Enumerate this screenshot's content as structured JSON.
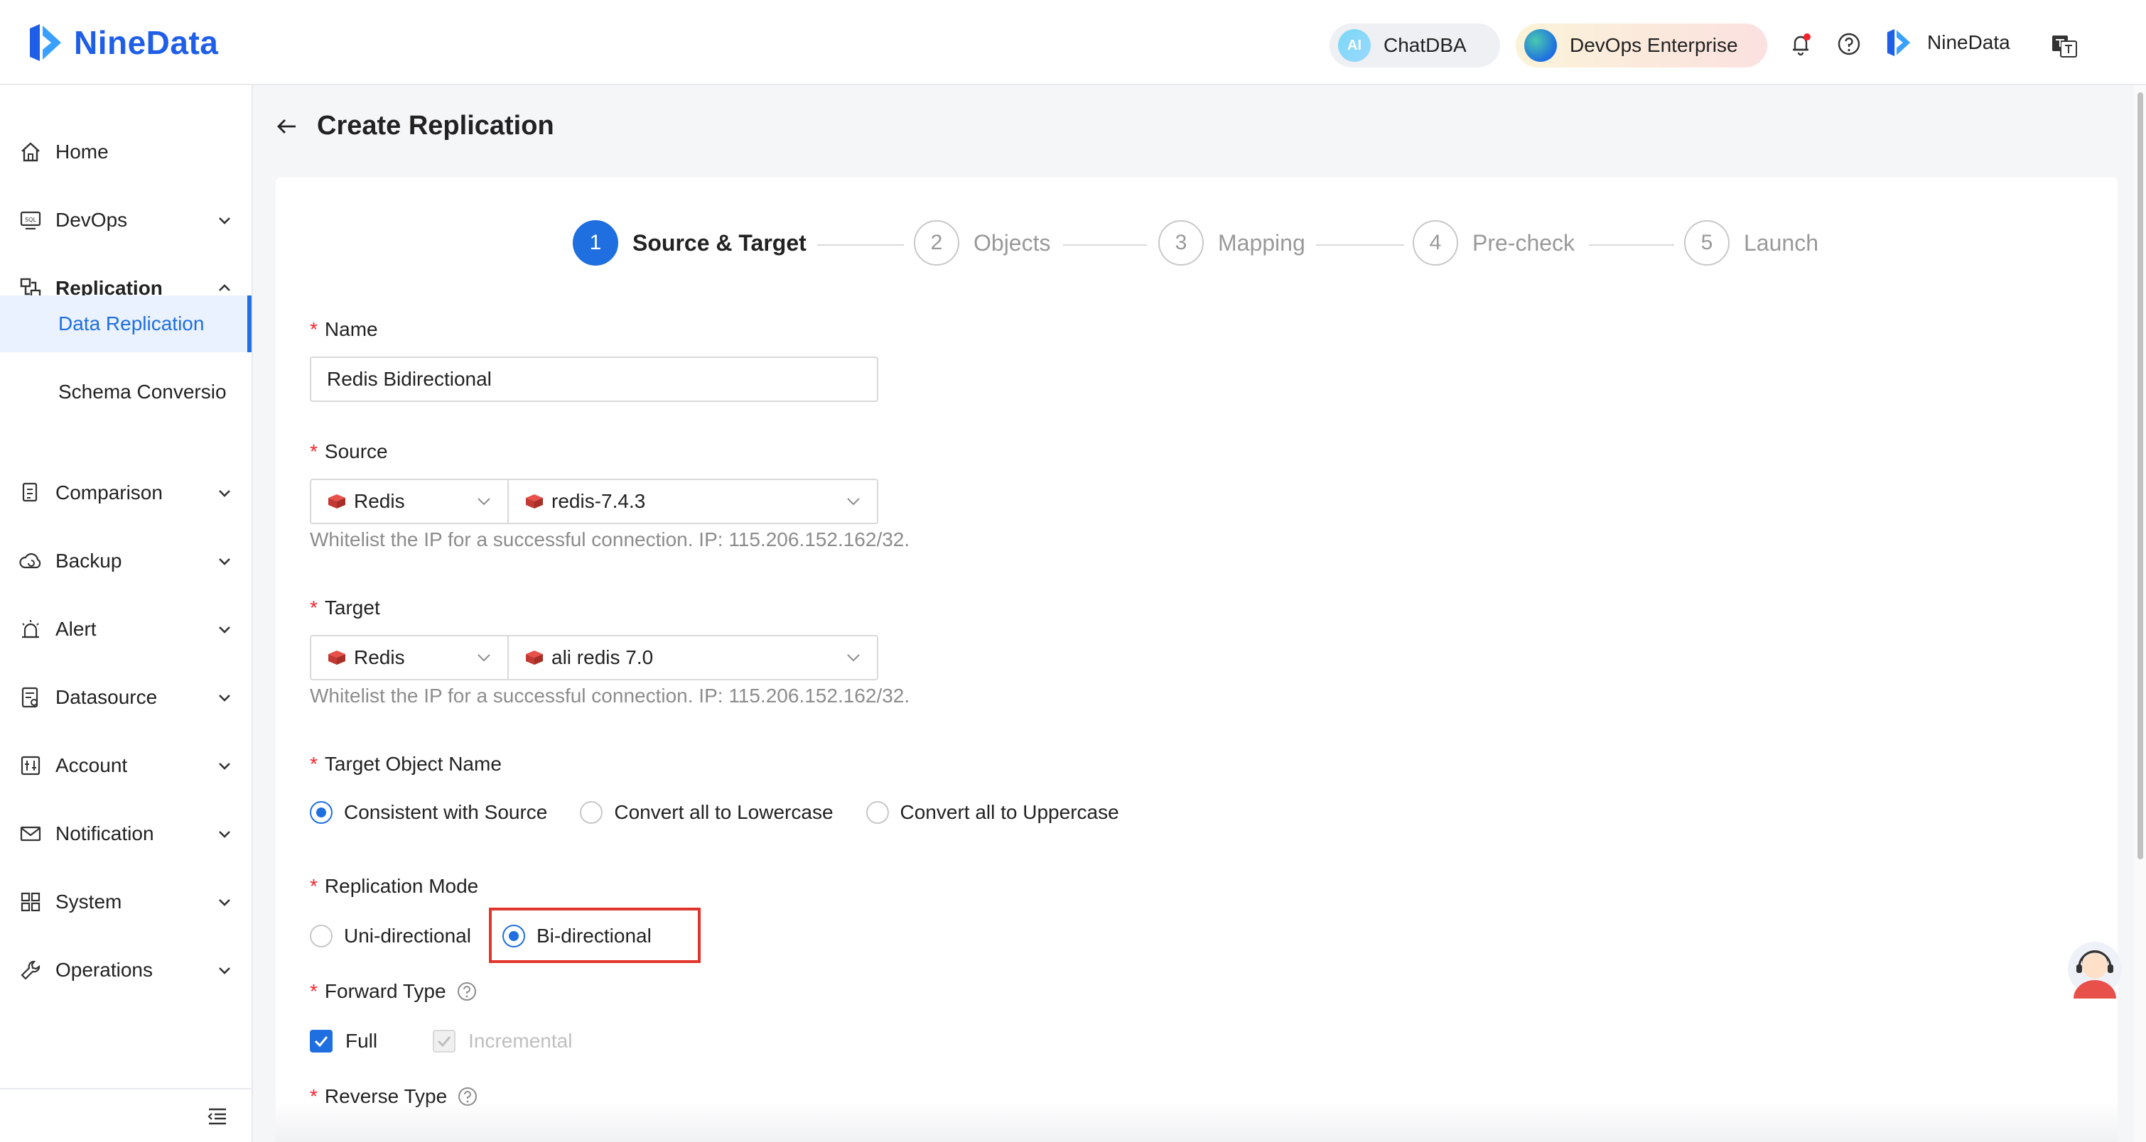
{
  "app": {
    "name": "NineData",
    "brand_color": "#1f5fe8",
    "accent_color": "#1f6fe0",
    "highlight_color": "#e0352b"
  },
  "header": {
    "chatdba_label": "ChatDBA",
    "chatdba_icon_text": "AI",
    "devops_label": "DevOps Enterprise",
    "org_label": "NineData",
    "icons": [
      "bell-icon",
      "help-icon",
      "language-icon"
    ]
  },
  "sidebar": {
    "items": [
      {
        "label": "Home",
        "icon": "home-icon"
      },
      {
        "label": "DevOps",
        "icon": "sql-icon",
        "expandable": true
      },
      {
        "label": "Replication",
        "icon": "replication-icon",
        "expanded": true
      },
      {
        "label": "Comparison",
        "icon": "comparison-icon",
        "expandable": true
      },
      {
        "label": "Backup",
        "icon": "cloud-backup-icon",
        "expandable": true
      },
      {
        "label": "Alert",
        "icon": "alarm-icon",
        "expandable": true
      },
      {
        "label": "Datasource",
        "icon": "datasource-icon",
        "expandable": true
      },
      {
        "label": "Account",
        "icon": "account-icon",
        "expandable": true
      },
      {
        "label": "Notification",
        "icon": "mail-icon",
        "expandable": true
      },
      {
        "label": "System",
        "icon": "grid-icon",
        "expandable": true
      },
      {
        "label": "Operations",
        "icon": "wrench-icon",
        "expandable": true
      }
    ],
    "sub_items": [
      {
        "label": "Data Replication",
        "active": true
      },
      {
        "label": "Schema Conversio",
        "active": false
      }
    ]
  },
  "page": {
    "title": "Create Replication"
  },
  "steps": [
    {
      "num": "1",
      "label": "Source & Target",
      "active": true
    },
    {
      "num": "2",
      "label": "Objects"
    },
    {
      "num": "3",
      "label": "Mapping"
    },
    {
      "num": "4",
      "label": "Pre-check"
    },
    {
      "num": "5",
      "label": "Launch"
    }
  ],
  "form": {
    "name": {
      "label": "Name",
      "value": "Redis Bidirectional"
    },
    "source": {
      "label": "Source",
      "type_value": "Redis",
      "instance_value": "redis-7.4.3",
      "hint": "Whitelist the IP for a successful connection. IP: 115.206.152.162/32."
    },
    "target": {
      "label": "Target",
      "type_value": "Redis",
      "instance_value": "ali redis 7.0",
      "hint": "Whitelist the IP for a successful connection. IP: 115.206.152.162/32."
    },
    "target_object_name": {
      "label": "Target Object Name",
      "options": [
        "Consistent with Source",
        "Convert all to Lowercase",
        "Convert all to Uppercase"
      ],
      "selected": "Consistent with Source"
    },
    "replication_mode": {
      "label": "Replication Mode",
      "options": [
        "Uni-directional",
        "Bi-directional"
      ],
      "selected": "Bi-directional"
    },
    "forward_type": {
      "label": "Forward Type",
      "full_label": "Full",
      "full_checked": true,
      "incremental_label": "Incremental",
      "incremental_checked": true,
      "incremental_disabled": true
    },
    "reverse_type": {
      "label": "Reverse Type"
    }
  }
}
